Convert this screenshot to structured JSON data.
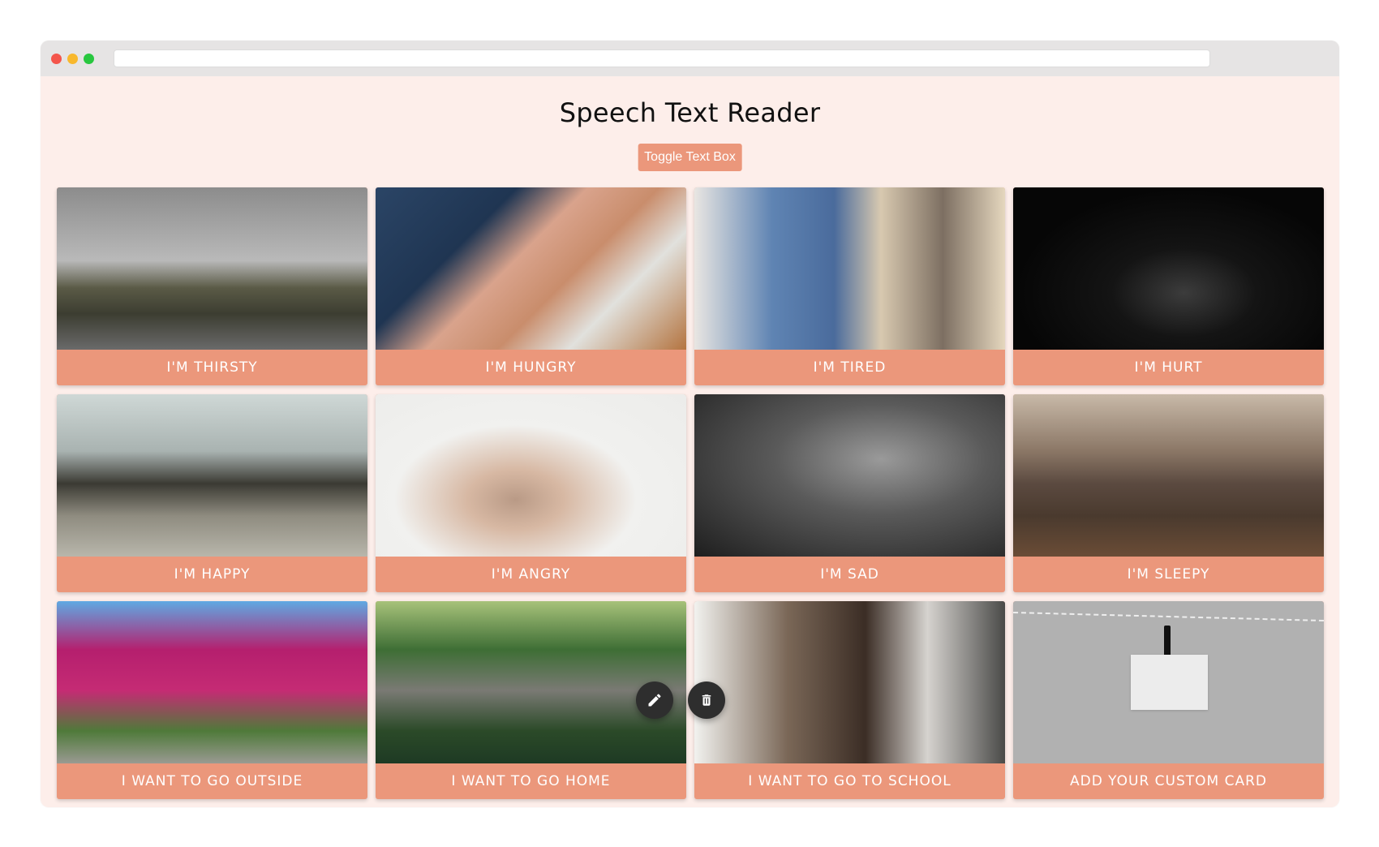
{
  "app": {
    "title": "Speech Text Reader",
    "address_bar": ""
  },
  "toolbar": {
    "toggle_label": "Toggle Text Box"
  },
  "cards": [
    {
      "label": "I'm Thirsty",
      "image": "thirsty"
    },
    {
      "label": "I'm Hungry",
      "image": "hungry"
    },
    {
      "label": "I'm Tired",
      "image": "tired"
    },
    {
      "label": "I'm Hurt",
      "image": "hurt"
    },
    {
      "label": "I'm Happy",
      "image": "happy"
    },
    {
      "label": "I'm Angry",
      "image": "angry"
    },
    {
      "label": "I'm Sad",
      "image": "sad"
    },
    {
      "label": "I'm Sleepy",
      "image": "sleepy"
    },
    {
      "label": "I Want To Go Outside",
      "image": "outside"
    },
    {
      "label": "I Want To Go Home",
      "image": "home"
    },
    {
      "label": "I Want To Go To School",
      "image": "school"
    },
    {
      "label": "Add Your Custom Card",
      "image": "custom"
    }
  ],
  "actions": {
    "edit_icon": "pencil-icon",
    "delete_icon": "trash-icon"
  },
  "colors": {
    "accent": "#eb977b",
    "page_background": "#fdeeea",
    "fab_background": "#2e2e2e"
  }
}
